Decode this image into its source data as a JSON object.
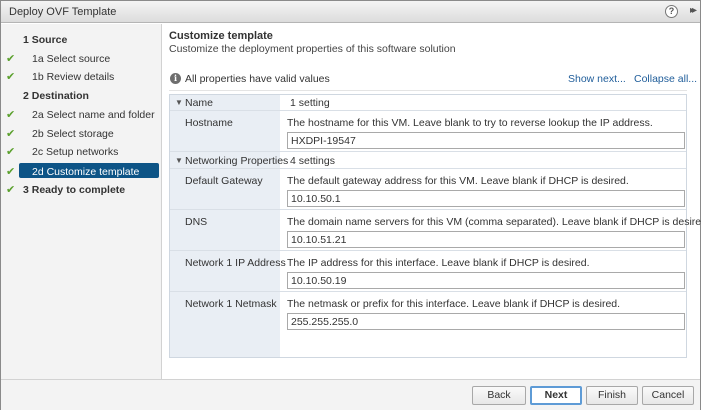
{
  "window": {
    "title": "Deploy OVF Template",
    "help_glyph": "?",
    "expand_glyph": "▸▸"
  },
  "nav": {
    "items": [
      {
        "label": "1  Source",
        "kind": "step",
        "done": false,
        "active": false
      },
      {
        "label": "1a  Select source",
        "kind": "sub",
        "done": true,
        "active": false
      },
      {
        "label": "1b  Review details",
        "kind": "sub",
        "done": true,
        "active": false
      },
      {
        "label": "2  Destination",
        "kind": "step",
        "done": false,
        "active": false
      },
      {
        "label": "2a  Select name and folder",
        "kind": "sub",
        "done": true,
        "active": false
      },
      {
        "label": "2b  Select storage",
        "kind": "sub",
        "done": true,
        "active": false
      },
      {
        "label": "2c  Setup networks",
        "kind": "sub",
        "done": true,
        "active": false
      },
      {
        "label": "2d  Customize template",
        "kind": "sub",
        "done": true,
        "active": true
      },
      {
        "label": "3  Ready to complete",
        "kind": "step",
        "done": true,
        "active": false
      }
    ],
    "check_glyph": "✔"
  },
  "main": {
    "title": "Customize template",
    "subtitle": "Customize the deployment properties of this software solution",
    "info_glyph": "i",
    "info_text": "All properties have valid values",
    "show_next": "Show next...",
    "collapse_all": "Collapse all..."
  },
  "groups": [
    {
      "name": "Name",
      "count": "1 setting",
      "props": [
        {
          "name": "Hostname",
          "desc": "The hostname for this VM. Leave blank to try to reverse lookup the IP address.",
          "value": "HXDPI-19547"
        }
      ]
    },
    {
      "name": "Networking Properties",
      "count": "4 settings",
      "props": [
        {
          "name": "Default Gateway",
          "desc": "The default gateway address for this VM. Leave blank if DHCP is desired.",
          "value": "10.10.50.1"
        },
        {
          "name": "DNS",
          "desc": "The domain name servers for this VM (comma separated). Leave blank if DHCP is desired.",
          "value": "10.10.51.21"
        },
        {
          "name": "Network 1 IP Address",
          "desc": "The IP address for this interface. Leave blank if DHCP is desired.",
          "value": "10.10.50.19"
        },
        {
          "name": "Network 1 Netmask",
          "desc": "The netmask or prefix for this interface. Leave blank if DHCP is desired.",
          "value": "255.255.255.0"
        }
      ]
    }
  ],
  "footer": {
    "back": "Back",
    "next": "Next",
    "finish": "Finish",
    "cancel": "Cancel"
  },
  "colors": {
    "accent": "#0d5486",
    "check": "#5aa02c",
    "link": "#1f5d9a"
  }
}
